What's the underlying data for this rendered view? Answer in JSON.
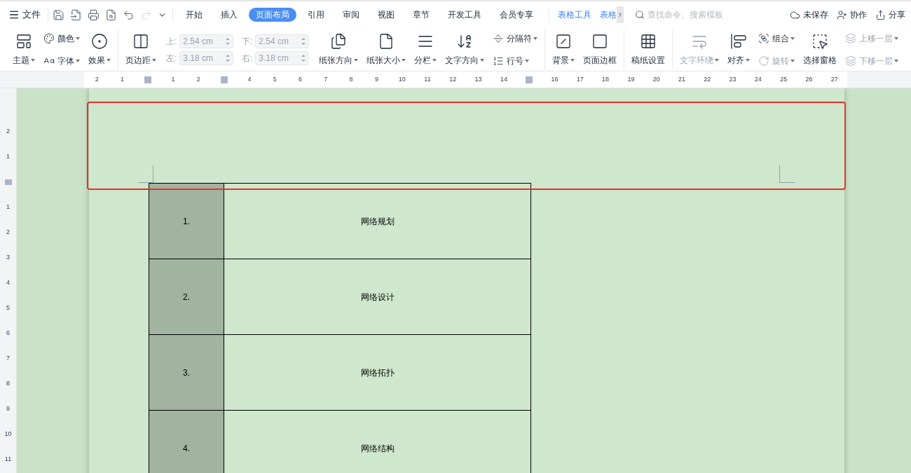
{
  "menu": {
    "label": "文件"
  },
  "tabs": [
    {
      "label": "开始",
      "selected": false
    },
    {
      "label": "插入",
      "selected": false
    },
    {
      "label": "页面布局",
      "selected": true
    },
    {
      "label": "引用",
      "selected": false
    },
    {
      "label": "审阅",
      "selected": false
    },
    {
      "label": "视图",
      "selected": false
    },
    {
      "label": "章节",
      "selected": false
    },
    {
      "label": "开发工具",
      "selected": false
    },
    {
      "label": "会员专享",
      "selected": false
    }
  ],
  "context_tabs": [
    {
      "label": "表格工具",
      "selected": false
    },
    {
      "label": "表格",
      "selected": false
    }
  ],
  "search": {
    "placeholder": "查找命令、搜索模板"
  },
  "actions": [
    {
      "label": "未保存"
    },
    {
      "label": "协作"
    },
    {
      "label": "分享"
    }
  ],
  "ribbon": [
    {
      "items": [
        {
          "kind": "large",
          "label": "主题",
          "dropdown": true,
          "disabled": false
        },
        {
          "kind": "stack",
          "items": [
            {
              "label": "颜色",
              "dropdown": true,
              "disabled": false
            },
            {
              "label": "字体",
              "dropdown": true,
              "disabled": false
            }
          ]
        },
        {
          "kind": "large",
          "label": "效果",
          "dropdown": true,
          "disabled": false
        }
      ]
    },
    {
      "items": [
        {
          "kind": "large",
          "label": "页边距",
          "dropdown": true,
          "disabled": false
        },
        {
          "kind": "fields",
          "fields": [
            {
              "label": "上:",
              "value": "2.54 cm",
              "disabled": true
            },
            {
              "label": "下:",
              "value": "2.54 cm",
              "disabled": true
            },
            {
              "label": "左:",
              "value": "3.18 cm",
              "disabled": true
            },
            {
              "label": "右:",
              "value": "3.18 cm",
              "disabled": true
            }
          ]
        },
        {
          "kind": "large",
          "label": "纸张方向",
          "dropdown": true,
          "disabled": false
        },
        {
          "kind": "large",
          "label": "纸张大小",
          "dropdown": true,
          "disabled": false
        },
        {
          "kind": "large",
          "label": "分栏",
          "dropdown": true,
          "disabled": false
        },
        {
          "kind": "large",
          "label": "文字方向",
          "dropdown": true,
          "disabled": false
        },
        {
          "kind": "stack",
          "items": [
            {
              "label": "分隔符",
              "dropdown": true,
              "disabled": false
            },
            {
              "label": "行号",
              "dropdown": true,
              "disabled": false
            }
          ]
        }
      ]
    },
    {
      "items": [
        {
          "kind": "large",
          "label": "背景",
          "dropdown": true,
          "disabled": false
        },
        {
          "kind": "large",
          "label": "页面边框",
          "dropdown": false,
          "disabled": false
        }
      ]
    },
    {
      "items": [
        {
          "kind": "large",
          "label": "稿纸设置",
          "dropdown": false,
          "disabled": false
        }
      ]
    },
    {
      "items": [
        {
          "kind": "large",
          "label": "文字环绕",
          "dropdown": true,
          "disabled": true
        },
        {
          "kind": "large",
          "label": "对齐",
          "dropdown": true,
          "disabled": false
        },
        {
          "kind": "stack",
          "items": [
            {
              "label": "组合",
              "dropdown": true,
              "disabled": false
            },
            {
              "label": "旋转",
              "dropdown": true,
              "disabled": true
            }
          ]
        },
        {
          "kind": "large",
          "label": "选择窗格",
          "dropdown": false,
          "disabled": false
        },
        {
          "kind": "stack",
          "items": [
            {
              "label": "上移一层",
              "dropdown": true,
              "disabled": true
            },
            {
              "label": "下移一层",
              "dropdown": true,
              "disabled": true
            }
          ]
        }
      ]
    }
  ],
  "ruler": [
    {
      "kind": "number",
      "label": "2"
    },
    {
      "kind": "number",
      "label": "1"
    },
    {
      "kind": "marker"
    },
    {
      "kind": "number",
      "label": "1"
    },
    {
      "kind": "number",
      "label": "2"
    },
    {
      "kind": "marker"
    },
    {
      "kind": "number",
      "label": "4"
    },
    {
      "kind": "number",
      "label": "5"
    },
    {
      "kind": "number",
      "label": "6"
    },
    {
      "kind": "number",
      "label": "7"
    },
    {
      "kind": "number",
      "label": "8"
    },
    {
      "kind": "number",
      "label": "9"
    },
    {
      "kind": "number",
      "label": "10"
    },
    {
      "kind": "number",
      "label": "11"
    },
    {
      "kind": "number",
      "label": "12"
    },
    {
      "kind": "number",
      "label": "13"
    },
    {
      "kind": "number",
      "label": "14"
    },
    {
      "kind": "marker"
    },
    {
      "kind": "number",
      "label": "16"
    },
    {
      "kind": "number",
      "label": "17"
    },
    {
      "kind": "number",
      "label": "18"
    },
    {
      "kind": "number",
      "label": "19"
    },
    {
      "kind": "number",
      "label": "20"
    },
    {
      "kind": "number",
      "label": "21"
    },
    {
      "kind": "number",
      "label": "22"
    },
    {
      "kind": "number",
      "label": "23"
    },
    {
      "kind": "number",
      "label": "24"
    },
    {
      "kind": "number",
      "label": "25"
    },
    {
      "kind": "number",
      "label": "26"
    },
    {
      "kind": "number",
      "label": "27"
    }
  ],
  "vertical_ruler": [
    {
      "kind": "number",
      "label": "2"
    },
    {
      "kind": "number",
      "label": "1"
    },
    {
      "kind": "marker"
    },
    {
      "kind": "number",
      "label": "1"
    },
    {
      "kind": "number",
      "label": "2"
    },
    {
      "kind": "number",
      "label": "3"
    },
    {
      "kind": "number",
      "label": "4"
    },
    {
      "kind": "number",
      "label": "5"
    },
    {
      "kind": "number",
      "label": "6"
    },
    {
      "kind": "number",
      "label": "7"
    },
    {
      "kind": "number",
      "label": "8"
    },
    {
      "kind": "number",
      "label": "9"
    },
    {
      "kind": "number",
      "label": "10"
    },
    {
      "kind": "number",
      "label": "11"
    }
  ],
  "table": {
    "rows": [
      {
        "number": "1.",
        "text": "网络规划"
      },
      {
        "number": "2.",
        "text": "网络设计"
      },
      {
        "number": "3.",
        "text": "网络拓扑"
      },
      {
        "number": "4.",
        "text": "网络结构"
      }
    ]
  }
}
